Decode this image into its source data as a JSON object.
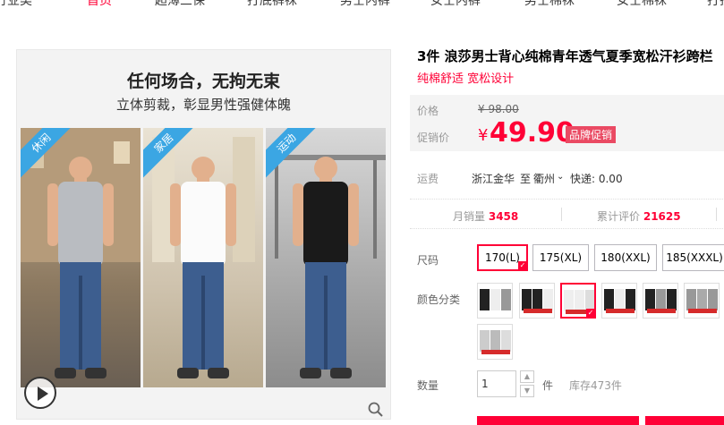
{
  "nav": {
    "items": [
      "行业类",
      "首页",
      "超薄三保",
      "打底裤袜",
      "男士内裤",
      "女士内裤",
      "男士棉袜",
      "女士棉袜",
      "打折"
    ],
    "active_index": 1
  },
  "gallery": {
    "headline": "任何场合，无拘无束",
    "subline": "立体剪裁，彰显男性强健体魄",
    "tags": [
      "休闲",
      "家居",
      "运动"
    ]
  },
  "product": {
    "title": "3件 浪莎男士背心纯棉青年透气夏季宽松汗衫跨栏",
    "subtitle": "纯棉舒适 宽松设计",
    "price_label": "价格",
    "price_original": "¥ 98.00",
    "promo_label": "促销价",
    "promo_symbol": "¥",
    "promo_price": "49.90",
    "promo_badge": "品牌促销",
    "ship_label": "运费",
    "ship_from": "浙江金华",
    "ship_to_word": "至",
    "ship_to": "衢州",
    "ship_fee": "快递: 0.00",
    "monthly_label": "月销量",
    "monthly_value": "3458",
    "reviews_label": "累计评价",
    "reviews_value": "21625",
    "size_label": "尺码",
    "sizes": [
      "170(L)",
      "175(XL)",
      "180(XXL)",
      "185(XXXL)"
    ],
    "selected_size_index": 0,
    "color_label": "颜色分类",
    "selected_color_index": 2,
    "qty_label": "数量",
    "qty_value": "1",
    "qty_unit": "件",
    "stock": "库存473件"
  },
  "colors": {
    "accent": "#ff0036",
    "tag_blue": "#3ba6e3",
    "badge": "#ea4a63"
  }
}
